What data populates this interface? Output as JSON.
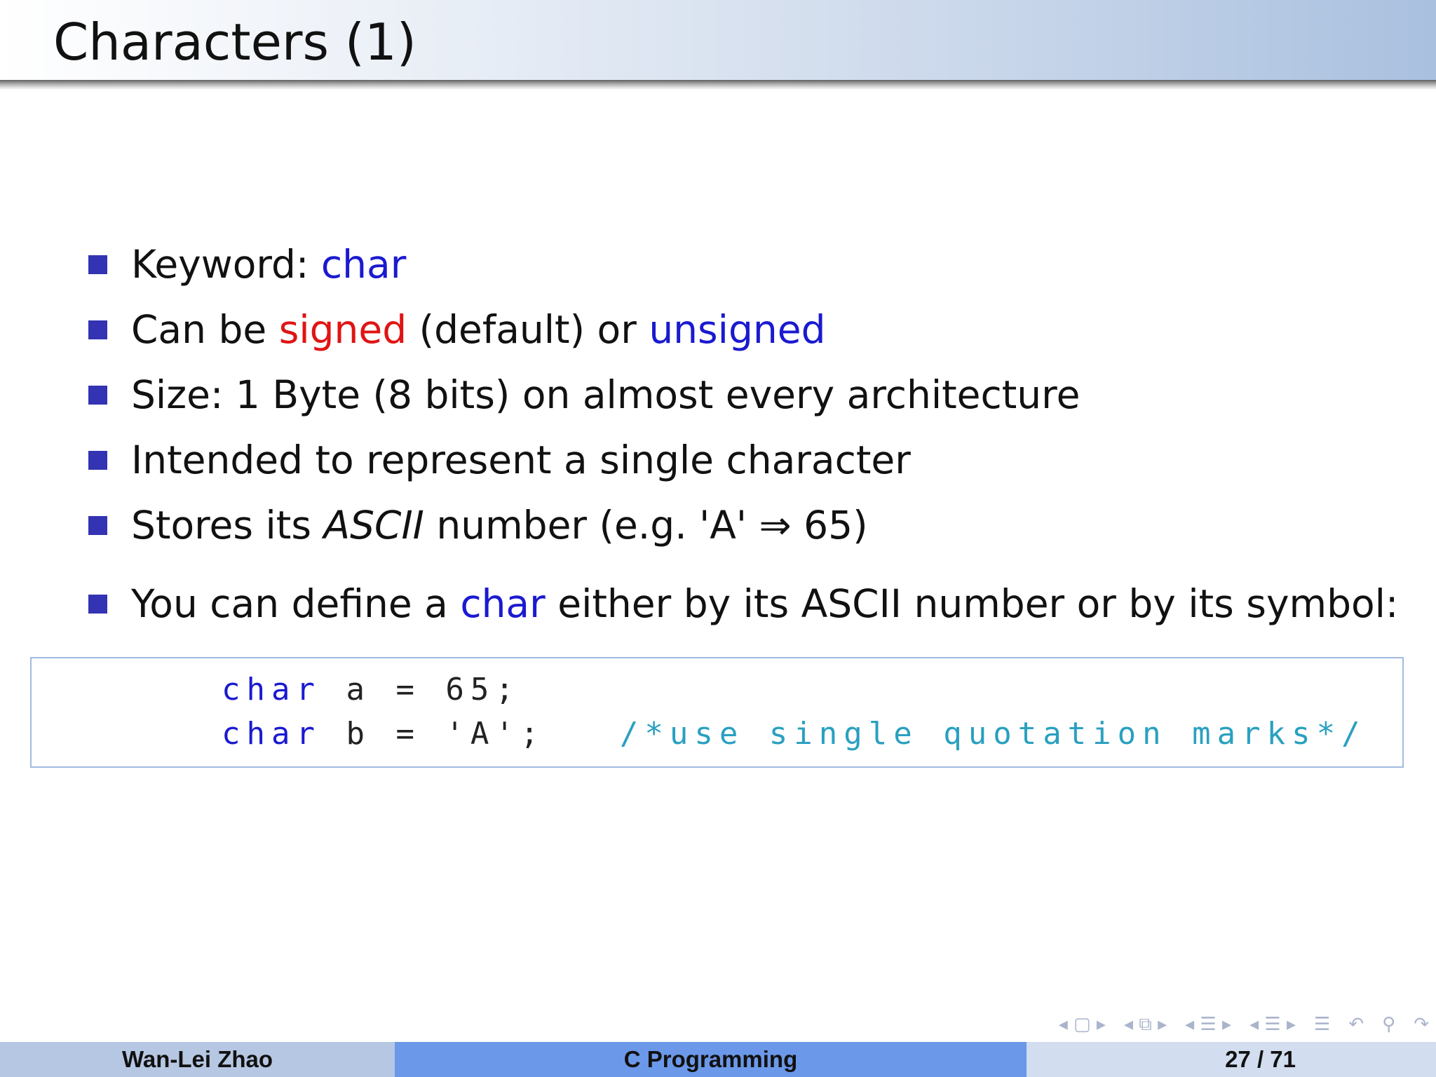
{
  "slide": {
    "title": "Characters (1)"
  },
  "bullets": [
    {
      "prefix": "Keyword: ",
      "keyword": "char"
    },
    {
      "prefix": "Can be ",
      "signed": "signed",
      "middle": " (default) or ",
      "unsigned": "unsigned"
    },
    {
      "text": "Size: 1 Byte (8 bits) on almost every architecture"
    },
    {
      "text": "Intended to represent a single character"
    },
    {
      "prefix": "Stores its ",
      "italic": "ASCII",
      "suffix": " number (e.g. 'A' ⇒ 65)"
    },
    {
      "prefix": "You can define a ",
      "keyword": "char",
      "suffix": " either by its ASCII number or by its symbol:"
    }
  ],
  "code": {
    "line1": {
      "keyword": "char",
      "rest": " a = 65;"
    },
    "line2": {
      "keyword": "char",
      "rest": " b = 'A';   ",
      "comment": "/*use single quotation marks*/"
    }
  },
  "colors": {
    "keyword": "#1a1ad0",
    "signed": "#e01414",
    "bullet": "#3333b3",
    "comment": "#2aa0c0"
  },
  "footer": {
    "author": "Wan-Lei Zhao",
    "course": "C Programming",
    "page": "27 / 71"
  },
  "nav_icons": [
    "arrow-left-icon",
    "frame-icon",
    "arrow-right-icon",
    "arrow-left-icon",
    "subsection-icon",
    "arrow-right-icon",
    "arrow-left-icon",
    "section-icon",
    "arrow-right-icon",
    "arrow-left-icon",
    "outline-icon",
    "arrow-right-icon",
    "appendix-icon",
    "undo-icon",
    "search-icon",
    "redo-icon"
  ]
}
